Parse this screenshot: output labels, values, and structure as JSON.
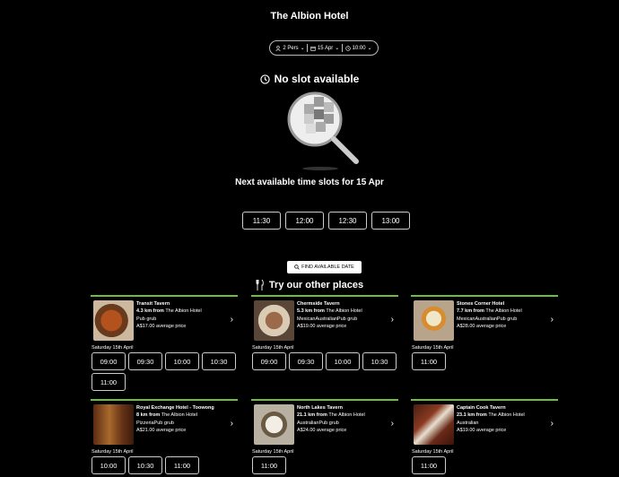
{
  "header": {
    "title": "The Albion Hotel"
  },
  "selector": {
    "persons": "2 Pers",
    "date": "15 Apr",
    "time": "10:00"
  },
  "status": {
    "message": "No slot available"
  },
  "next": {
    "heading": "Next available time slots for 15 Apr",
    "slots": [
      "11:30",
      "12:00",
      "12:30",
      "13:00"
    ]
  },
  "find_button": "FIND AVAILABLE DATE",
  "other": {
    "heading": "Try our other places"
  },
  "places": [
    {
      "name": "Transit Tavern",
      "dist": "4.3 km from",
      "from": "The Albion Hotel",
      "cuisine": "Pub grub",
      "price": "A$17.00 average price",
      "date": "Saturday 15th April",
      "times": [
        "09:00",
        "09:30",
        "10:00",
        "10:30",
        "11:00"
      ]
    },
    {
      "name": "Chermside Tavern",
      "dist": "5.3 km from",
      "from": "The Albion Hotel",
      "cuisine": "MexicanAustralianPub grub",
      "price": "A$19.00 average price",
      "date": "Saturday 15th April",
      "times": [
        "09:00",
        "09:30",
        "10:00",
        "10:30"
      ]
    },
    {
      "name": "Stones Corner Hotel",
      "dist": "7.7 km from",
      "from": "The Albion Hotel",
      "cuisine": "MexicanAustralianPub grub",
      "price": "A$28.00 average price",
      "date": "Saturday 15th April",
      "times": [
        "11:00"
      ]
    },
    {
      "name": "Royal Exchange Hotel - Toowong",
      "dist": "8 km from",
      "from": "The Albion Hotel",
      "cuisine": "PizzeriaPub grub",
      "price": "A$21.00 average price",
      "date": "Saturday 15th April",
      "times": [
        "10:00",
        "10:30",
        "11:00"
      ]
    },
    {
      "name": "North Lakes Tavern",
      "dist": "21.1 km from",
      "from": "The Albion Hotel",
      "cuisine": "AustralianPub grub",
      "price": "A$24.00 average price",
      "date": "Saturday 15th April",
      "times": [
        "11:00"
      ]
    },
    {
      "name": "Captain Cook Tavern",
      "dist": "23.1 km from",
      "from": "The Albion Hotel",
      "cuisine": "Australian",
      "price": "A$19.00 average price",
      "date": "Saturday 15th April",
      "times": [
        "11:00"
      ]
    }
  ]
}
